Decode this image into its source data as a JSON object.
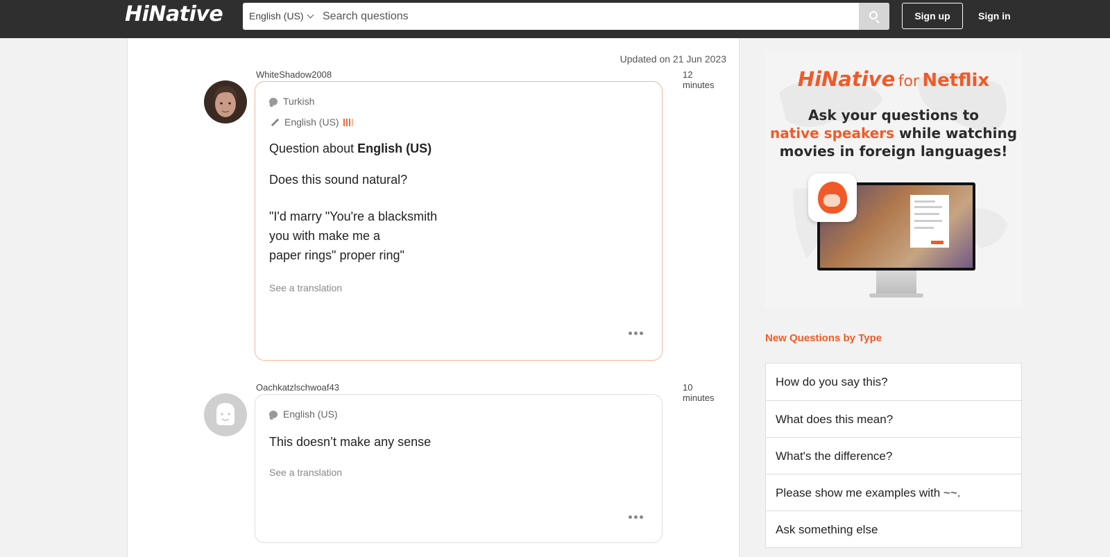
{
  "header": {
    "logo": "HiNative",
    "language": "English (US)",
    "search_placeholder": "Search questions",
    "signup_label": "Sign up",
    "signin_label": "Sign in"
  },
  "main": {
    "updated": "Updated on 21 Jun 2023",
    "questions": [
      {
        "username": "WhiteShadow2008",
        "time": "12 minutes",
        "native_language": "Turkish",
        "learning_language": "English (US)",
        "about_prefix": "Question about",
        "about_language": "English (US)",
        "question": "Does this sound natural?",
        "quote_lines": [
          "\"I'd marry \"You're a blacksmith",
          "you with make me a",
          "paper rings\" proper ring\""
        ],
        "see_translation": "See a translation"
      },
      {
        "username": "Oachkatzlschwoaf43",
        "time": "10 minutes",
        "native_language": "English (US)",
        "question": "This doesn’t make any sense",
        "see_translation": "See a translation"
      }
    ]
  },
  "ad": {
    "brand": "HiNative",
    "brand_for": "for",
    "brand_partner": "Netflix",
    "line1": "Ask your questions to",
    "line2_highlight": "native speakers",
    "line2_rest": "while watching",
    "line3": "movies in foreign languages!"
  },
  "sidebar": {
    "section_title": "New Questions by Type",
    "types": [
      "How do you say this?",
      "What does this mean?",
      "What's the difference?",
      "Please show me examples with ~~.",
      "Ask something else"
    ]
  },
  "colors": {
    "accent": "#f05a28",
    "header_bg": "#2f2f2f",
    "card_highlight_border": "#f9b49a"
  },
  "icons": [
    "search-icon",
    "chevron-down-icon",
    "speech-bubble-icon",
    "pencil-icon",
    "more-dots-icon",
    "avatar",
    "default-avatar-icon"
  ]
}
